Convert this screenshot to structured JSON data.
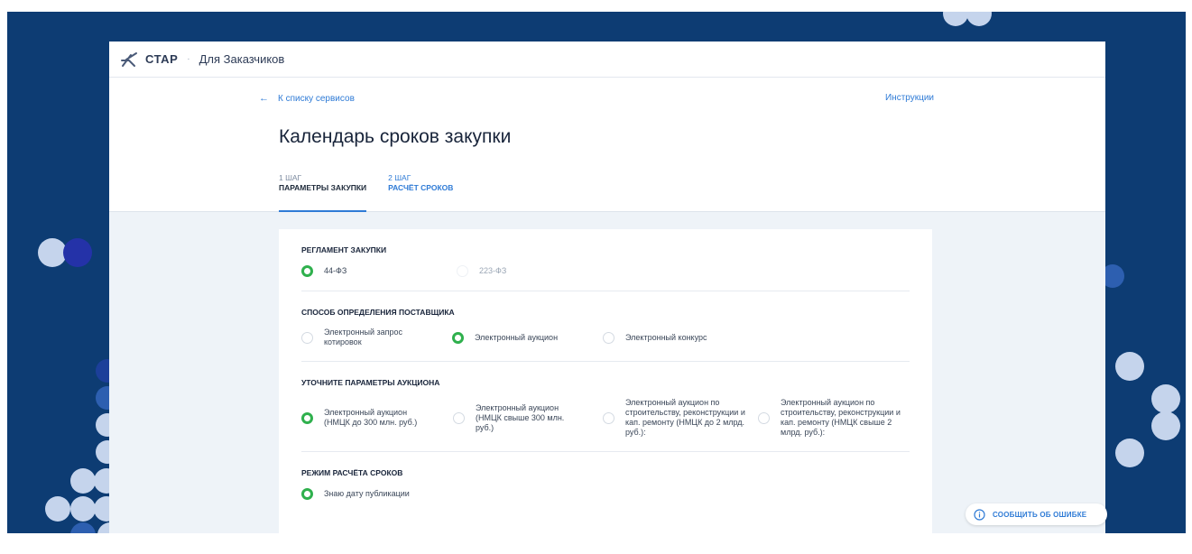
{
  "topbar": {
    "brand": "СТАР",
    "separator": "·",
    "breadcrumb": "Для Заказчиков"
  },
  "nav": {
    "back_label": "К списку сервисов",
    "instructions_label": "Инструкции"
  },
  "page": {
    "title": "Календарь сроков закупки"
  },
  "tabs": [
    {
      "step": "1 ШАГ",
      "label": "ПАРАМЕТРЫ ЗАКУПКИ",
      "active": true
    },
    {
      "step": "2 ШАГ",
      "label": "РАСЧЁТ СРОКОВ",
      "active": false
    }
  ],
  "sections": {
    "regulation": {
      "title": "РЕГЛАМЕНТ ЗАКУПКИ",
      "options": [
        {
          "label": "44-ФЗ",
          "selected": true
        },
        {
          "label": "223-ФЗ",
          "selected": false
        }
      ]
    },
    "method": {
      "title": "СПОСОБ ОПРЕДЕЛЕНИЯ ПОСТАВЩИКА",
      "options": [
        {
          "label": "Электронный запрос котировок",
          "selected": false
        },
        {
          "label": "Электронный аукцион",
          "selected": true
        },
        {
          "label": "Электронный конкурс",
          "selected": false
        }
      ]
    },
    "auction": {
      "title": "УТОЧНИТЕ ПАРАМЕТРЫ АУКЦИОНА",
      "options": [
        {
          "label": "Электронный аукцион (НМЦК до 300 млн. руб.)",
          "selected": true
        },
        {
          "label": "Электронный аукцион (НМЦК свыше 300 млн. руб.)",
          "selected": false
        },
        {
          "label": "Электронный аукцион по строительству, реконструкции и кап. ремонту (НМЦК до 2 млрд. руб.):",
          "selected": false
        },
        {
          "label": "Электронный аукцион по строительству, реконструкции и кап. ремонту (НМЦК свыше 2 млрд. руб.):",
          "selected": false
        }
      ]
    },
    "mode": {
      "title": "РЕЖИМ РАСЧЁТА СРОКОВ",
      "options": [
        {
          "label": "Знаю дату публикации",
          "selected": true
        }
      ]
    }
  },
  "report_button": {
    "label": "СООБЩИТЬ ОБ ОШИБКЕ"
  },
  "icons": {
    "logo": "star-logo-icon",
    "back": "arrow-left-icon",
    "info": "info-icon"
  },
  "colors": {
    "accent": "#2f7bd6",
    "selected": "#2fb04d",
    "background": "#0d3c73"
  }
}
